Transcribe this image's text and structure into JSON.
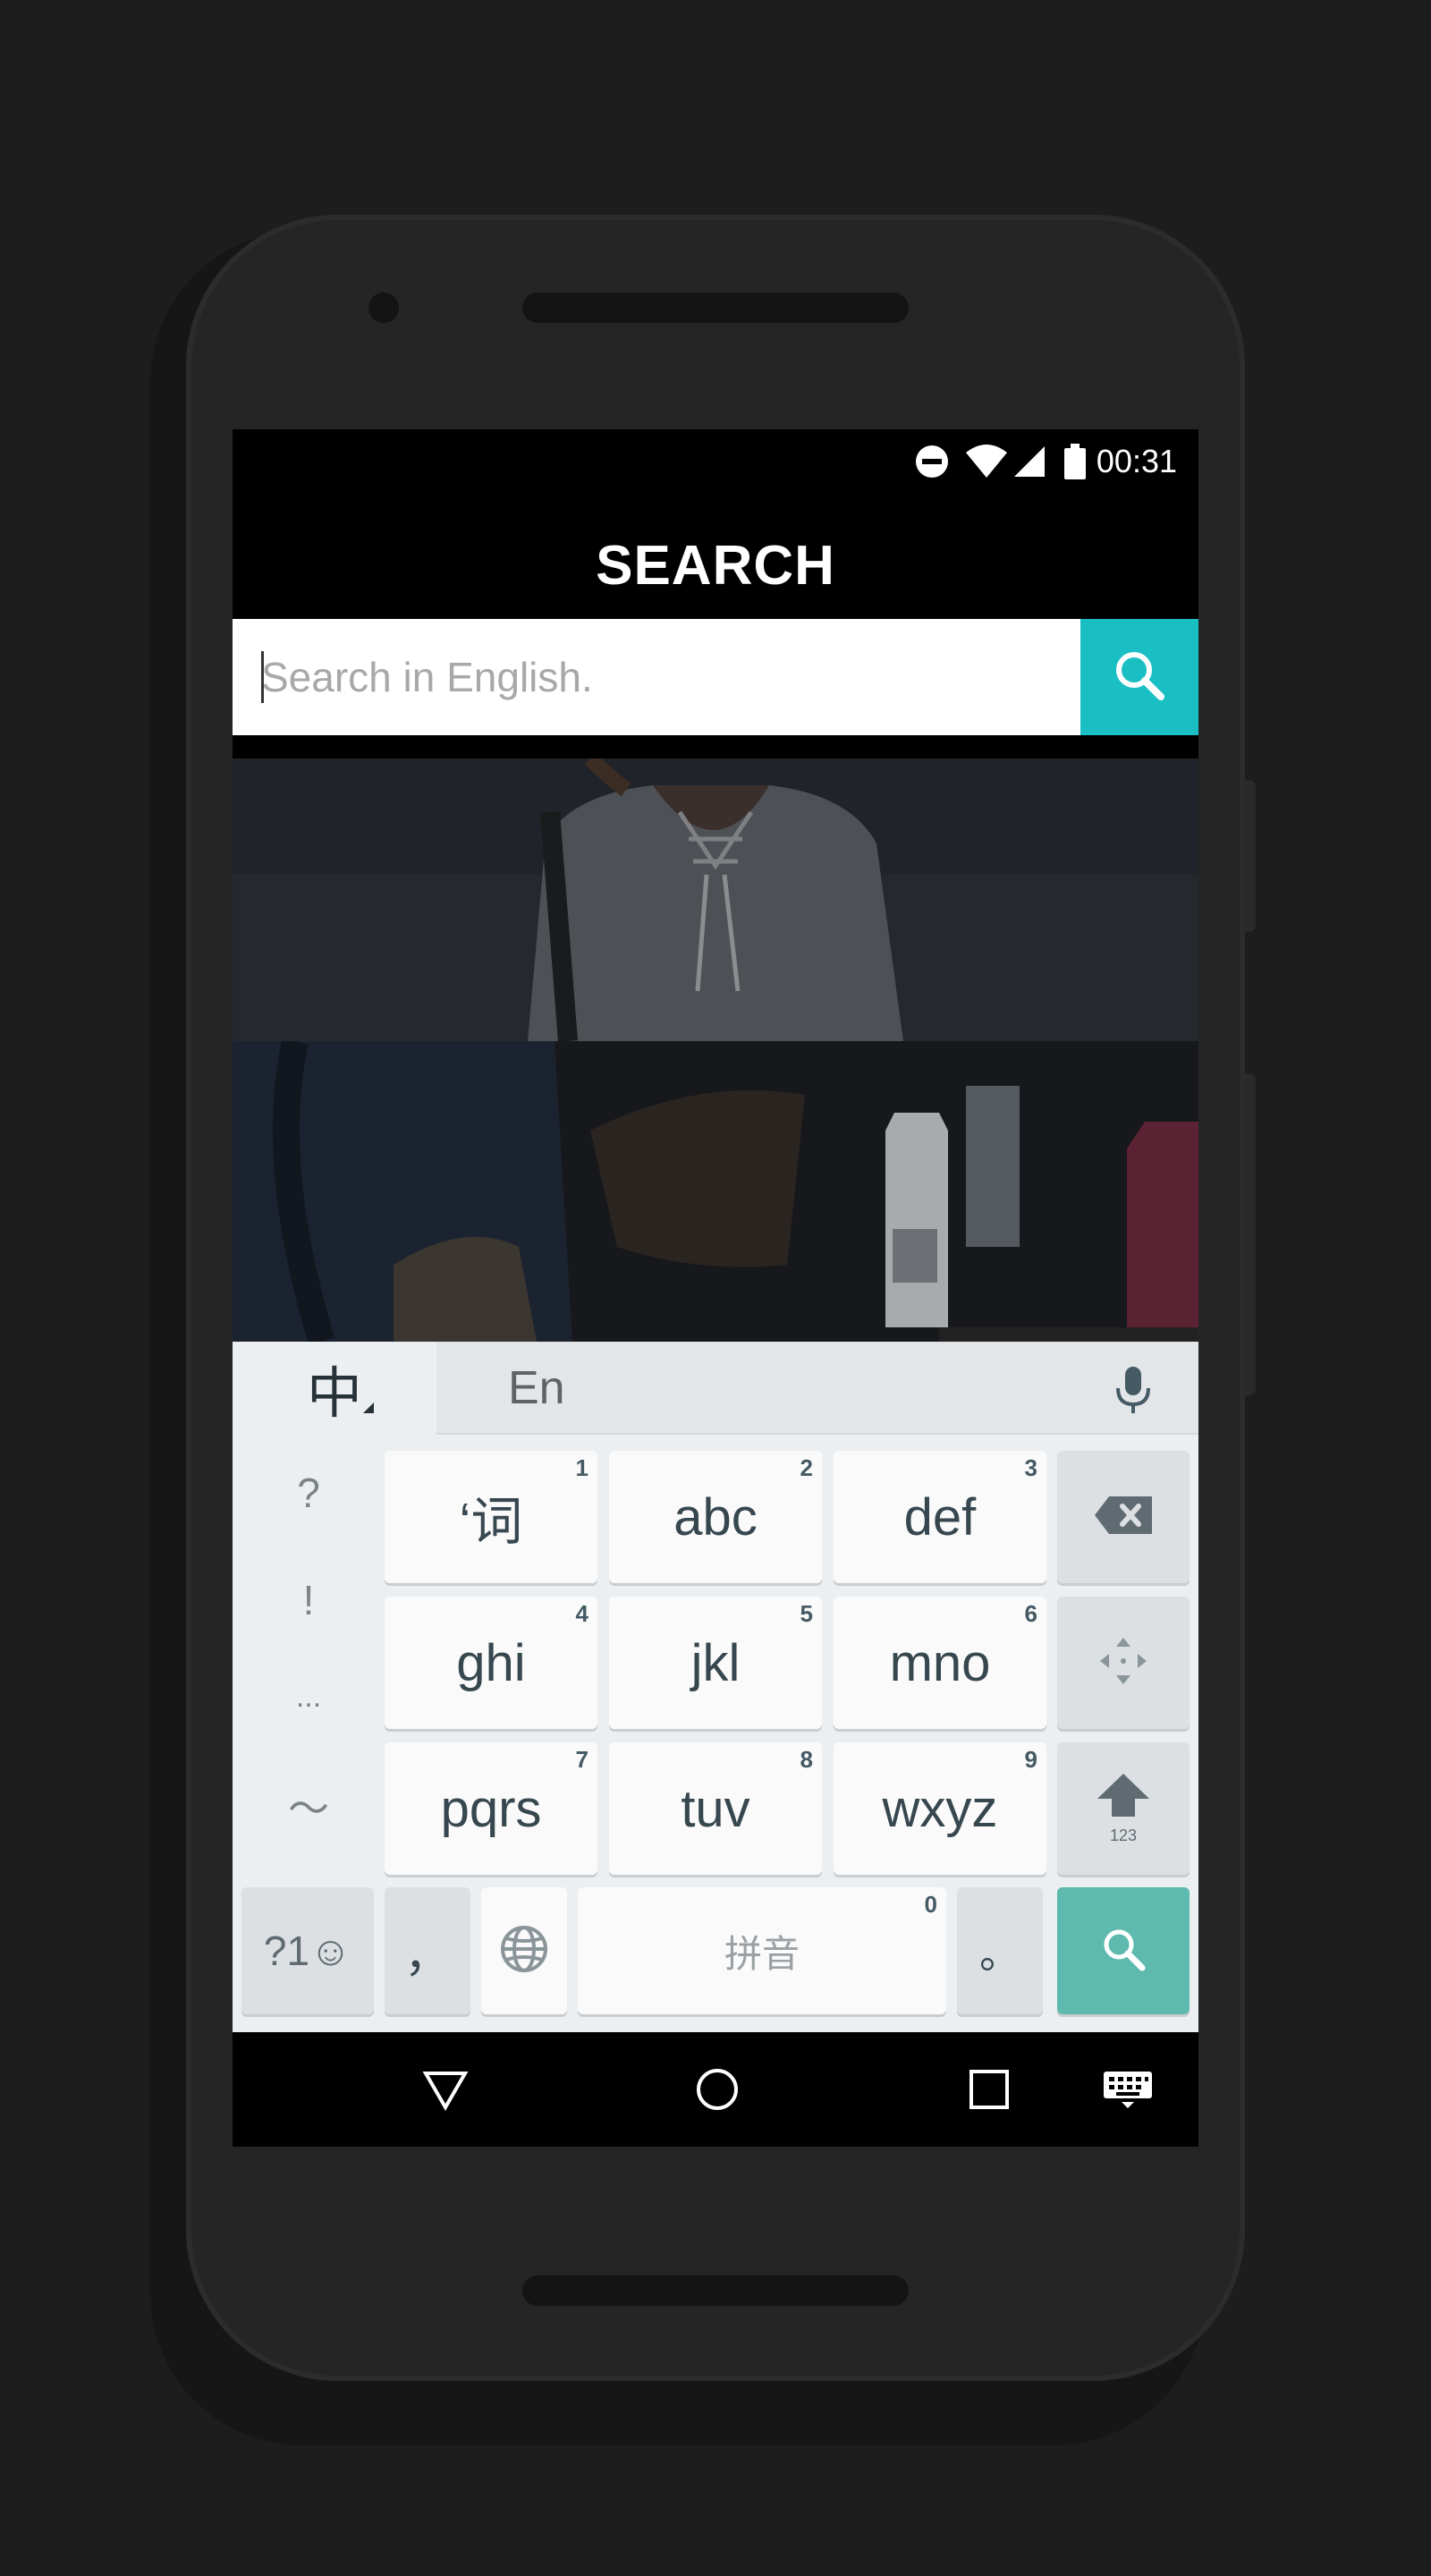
{
  "status_bar": {
    "time": "00:31",
    "icons": [
      "do-not-disturb-icon",
      "wifi-icon",
      "cell-signal-icon",
      "battery-icon"
    ]
  },
  "header": {
    "title": "SEARCH"
  },
  "search": {
    "placeholder": "Search in English.",
    "value": "",
    "button_icon": "search-icon",
    "accent_color": "#1abfc4"
  },
  "results": [
    {
      "icon": "photo-woman-hoodie"
    },
    {
      "icon": "photo-milk-cartons"
    }
  ],
  "keyboard": {
    "lang_active": "中",
    "lang_other": "En",
    "mic_icon": "mic-icon",
    "symbols": [
      "?",
      "!",
      "...",
      "～"
    ],
    "keys": [
      {
        "label": "‘词",
        "num": "1"
      },
      {
        "label": "abc",
        "num": "2"
      },
      {
        "label": "def",
        "num": "3"
      },
      {
        "label": "ghi",
        "num": "4"
      },
      {
        "label": "jkl",
        "num": "5"
      },
      {
        "label": "mno",
        "num": "6"
      },
      {
        "label": "pqrs",
        "num": "7"
      },
      {
        "label": "tuv",
        "num": "8"
      },
      {
        "label": "wxyz",
        "num": "9"
      }
    ],
    "shift_sub": "123",
    "bottom": {
      "symbols_emoji": "?1☺",
      "comma": "，",
      "space_label": "拼音",
      "space_num": "0",
      "period": "。"
    },
    "enter_color": "#5ebaae"
  },
  "nav_bar": {
    "buttons": [
      "back-icon",
      "home-icon",
      "recents-icon",
      "keyboard-switch-icon"
    ]
  }
}
